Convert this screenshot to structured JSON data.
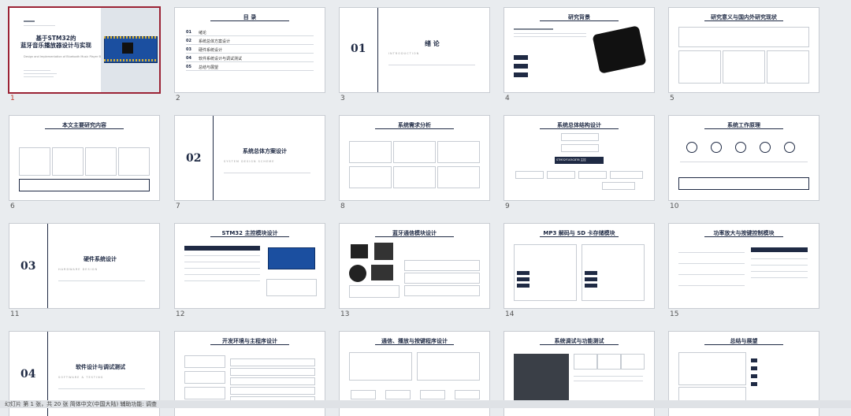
{
  "slides": [
    {
      "n": "1",
      "title": "基于STM32的\n蓝牙音乐播放器设计与实现",
      "subtitle": "Design and Implementation of Bluetooth Music Player Based on STM32"
    },
    {
      "n": "2",
      "title": "目 录",
      "toc": [
        "01",
        "02",
        "03",
        "04",
        "05"
      ],
      "toc_items": [
        "绪论",
        "系统总体方案设计",
        "硬件系统设计",
        "软件系统设计与调试测试",
        "总结与展望"
      ]
    },
    {
      "n": "3",
      "big": "01",
      "title": "绪 论",
      "sub": "INTRODUCTION"
    },
    {
      "n": "4",
      "title": "研究背景"
    },
    {
      "n": "5",
      "title": "研究意义与国内外研究现状"
    },
    {
      "n": "6",
      "title": "本文主要研究内容"
    },
    {
      "n": "7",
      "big": "02",
      "title": "系统总体方案设计",
      "sub": "SYSTEM DESIGN SCHEME"
    },
    {
      "n": "8",
      "title": "系统需求分析"
    },
    {
      "n": "9",
      "title": "系统总体结构设计"
    },
    {
      "n": "10",
      "title": "系统工作原理"
    },
    {
      "n": "11",
      "big": "03",
      "title": "硬件系统设计",
      "sub": "HARDWARE DESIGN"
    },
    {
      "n": "12",
      "title": "STM32 主控模块设计"
    },
    {
      "n": "13",
      "title": "蓝牙通信模块设计"
    },
    {
      "n": "14",
      "title": "MP3 解码与 SD 卡存储模块"
    },
    {
      "n": "15",
      "title": "功率放大与按键控制模块"
    },
    {
      "n": "",
      "big": "04",
      "title": "软件设计与调试测试",
      "sub": "SOFTWARE & TESTING"
    },
    {
      "n": "",
      "title": "开发环境与主程序设计"
    },
    {
      "n": "",
      "title": "通信、播放与按键程序设计"
    },
    {
      "n": "",
      "title": "系统调试与功能测试"
    },
    {
      "n": "",
      "title": "总结与展望"
    }
  ],
  "slide9_boxes": [
    "STM32F103C8T6 主控",
    "按键控制",
    "SD 卡存储",
    "VS1053 解码",
    "PAM8403 功放",
    "蓝牙模块",
    "电源模块"
  ],
  "status_text": "幻灯片 第 1 张，共 20 张    简体中文(中国大陆)    辅助功能: 调查"
}
